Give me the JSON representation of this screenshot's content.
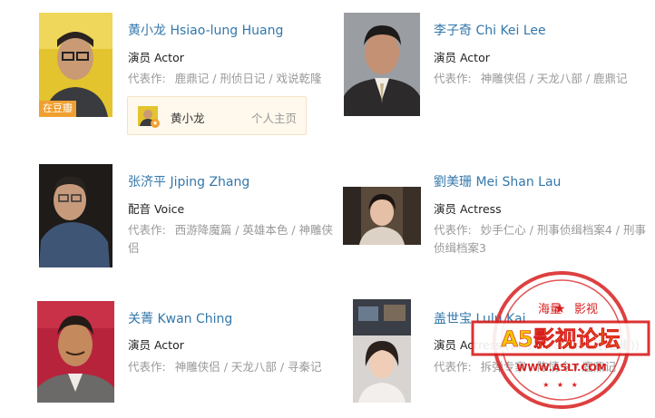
{
  "celebrities": [
    {
      "name": "黄小龙 Hsiao-lung Huang",
      "role": "演员 Actor",
      "works_label": "代表作:",
      "works": "鹿鼎记 / 刑侦日记 / 戏说乾隆",
      "badge": "在豆瓣"
    },
    {
      "name": "李子奇 Chi Kei Lee",
      "role": "演员 Actor",
      "works_label": "代表作:",
      "works": "神雕侠侣 / 天龙八部 / 鹿鼎记"
    },
    {
      "name": "张济平 Jiping Zhang",
      "role": "配音 Voice",
      "works_label": "代表作:",
      "works": "西游降魔篇 / 英雄本色 / 神雕侠侣"
    },
    {
      "name": "劉美珊 Mei Shan Lau",
      "role": "演员 Actress",
      "works_label": "代表作:",
      "works": "妙手仁心 / 刑事侦缉档案4 / 刑事侦缉档案3"
    },
    {
      "name": "关菁 Kwan Ching",
      "role": "演员 Actor",
      "works_label": "代表作:",
      "works": "神雕侠侣 / 天龙八部 / 寻秦记"
    },
    {
      "name": "盖世宝 Lulu Kai",
      "role": "演员 Actress (饰 小丫头 | 保安员(客串))",
      "works_label": "代表作:",
      "works": "拆弹专家 / 陈情令 / 鹿鼎记"
    }
  ],
  "personal_home": {
    "name": "黄小龙",
    "link": "个人主页"
  },
  "watermark": {
    "top_left": "海量",
    "top_right": "影视",
    "main": "A5影视论坛",
    "url": "WWW.A5LT.COM",
    "color": "#d81e1e"
  },
  "colors": {
    "link": "#3377aa",
    "muted": "#999999",
    "badge": "#f0a030"
  }
}
